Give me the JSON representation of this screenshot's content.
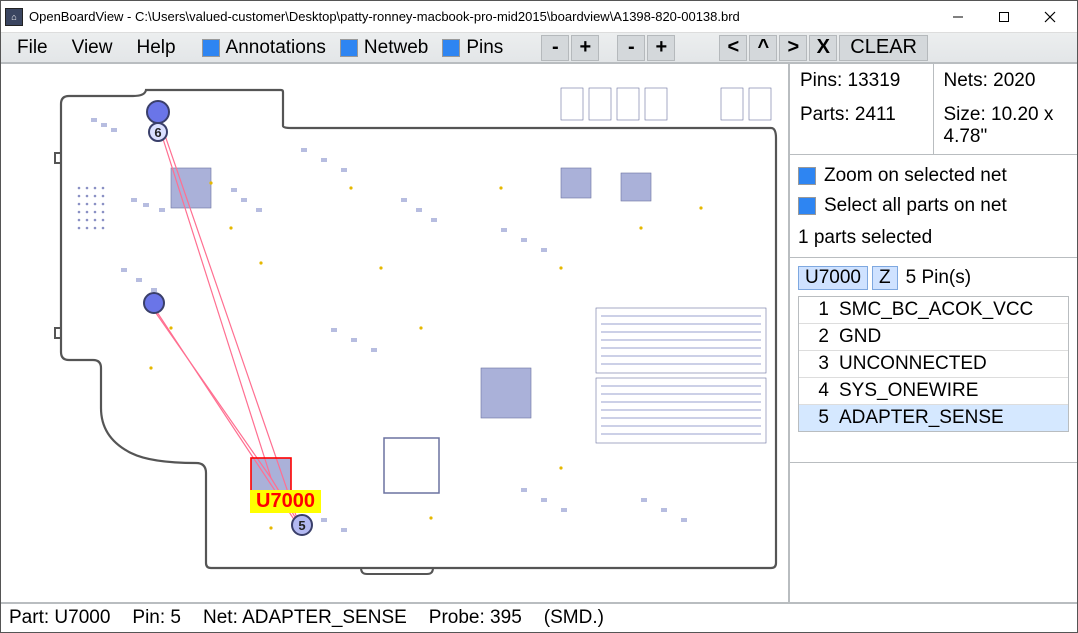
{
  "window": {
    "title": "OpenBoardView - C:\\Users\\valued-customer\\Desktop\\patty-ronney-macbook-pro-mid2015\\boardview\\A1398-820-00138.brd"
  },
  "menu": {
    "file": "File",
    "view": "View",
    "help": "Help"
  },
  "toolbar": {
    "annotations": "Annotations",
    "netweb": "Netweb",
    "pins": "Pins",
    "minus": "-",
    "plus": "+",
    "left": "<",
    "up": "^",
    "right": ">",
    "x": "X",
    "clear": "CLEAR"
  },
  "info": {
    "pins_label": "Pins:",
    "pins_value": "13319",
    "nets_label": "Nets:",
    "nets_value": "2020",
    "parts_label": "Parts:",
    "parts_value": "2411",
    "size_label": "Size:",
    "size_value": "10.20 x 4.78\""
  },
  "options": {
    "zoom_on_net": "Zoom on selected net",
    "select_all_parts": "Select all parts on net"
  },
  "selection": {
    "parts_selected": "1 parts selected",
    "part_ref": "U7000",
    "z_btn": "Z",
    "pin_count_label": "5 Pin(s)",
    "pins": [
      {
        "n": "1",
        "name": "SMC_BC_ACOK_VCC"
      },
      {
        "n": "2",
        "name": "GND"
      },
      {
        "n": "3",
        "name": "UNCONNECTED"
      },
      {
        "n": "4",
        "name": "SYS_ONEWIRE"
      },
      {
        "n": "5",
        "name": "ADAPTER_SENSE"
      }
    ],
    "selected_pin_index": 4
  },
  "board": {
    "highlight_label": "U7000",
    "pin_marker_a": "6",
    "pin_marker_b": "5"
  },
  "status": {
    "part": "Part: U7000",
    "pin": "Pin: 5",
    "net": "Net: ADAPTER_SENSE",
    "probe": "Probe: 395",
    "type": "(SMD.)"
  }
}
